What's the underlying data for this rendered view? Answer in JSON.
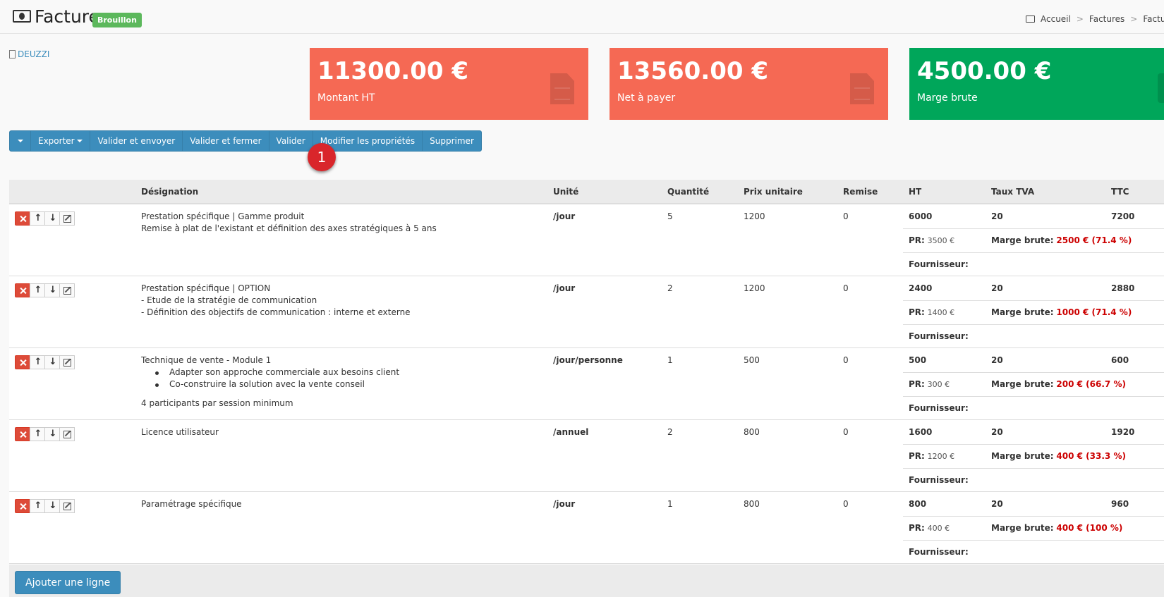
{
  "header": {
    "title": "Facture",
    "status_badge": "Brouillon",
    "breadcrumb": [
      "Accueil",
      ">",
      "Factures",
      ">",
      "Factures en"
    ]
  },
  "client": {
    "name": "DEUZZI",
    "icon": "building-icon"
  },
  "stats": [
    {
      "value": "11300.00 €",
      "label": "Montant HT",
      "color": "#f56954",
      "icon": "file-icon"
    },
    {
      "value": "13560.00 €",
      "label": "Net à payer",
      "color": "#f56954",
      "icon": "file-icon"
    },
    {
      "value": "4500.00 €",
      "label": "Marge brute",
      "color": "#00a65a",
      "icon": "money-icon"
    }
  ],
  "toolbar": {
    "export_label": "Exporter",
    "validate_send_label": "Valider et envoyer",
    "validate_close_label": "Valider et fermer",
    "validate_label": "Valider",
    "edit_props_label": "Modifier les propriétés",
    "delete_label": "Supprimer"
  },
  "marker": "1",
  "table": {
    "headers": {
      "designation": "Désignation",
      "unit": "Unité",
      "quantity": "Quantité",
      "unit_price": "Prix unitaire",
      "discount": "Remise",
      "ht": "HT",
      "vat_rate": "Taux TVA",
      "ttc": "TTC"
    },
    "pr_label": "PR:",
    "marge_label": "Marge brute:",
    "supplier_label": "Fournisseur:",
    "rows": [
      {
        "title": "Prestation spécifique | Gamme produit",
        "lines": [
          "Remise à plat de l'existant et définition des axes stratégiques à 5 ans"
        ],
        "unit": "/jour",
        "quantity": "5",
        "unit_price": "1200",
        "discount": "0",
        "ht": "6000",
        "vat": "20",
        "ttc": "7200",
        "pr": "3500 €",
        "marge": "2500 € (71.4 %)"
      },
      {
        "title": "Prestation spécifique | OPTION",
        "lines": [
          "- Etude de la stratégie de communication",
          "- Définition des objectifs de communication : interne et externe"
        ],
        "unit": "/jour",
        "quantity": "2",
        "unit_price": "1200",
        "discount": "0",
        "ht": "2400",
        "vat": "20",
        "ttc": "2880",
        "pr": "1400 €",
        "marge": "1000 € (71.4 %)"
      },
      {
        "title": "Technique de vente - Module 1",
        "bullets": [
          "Adapter son approche commerciale aux besoins client",
          "Co-construire la solution avec la vente conseil"
        ],
        "footer_line": "4 participants par session minimum",
        "unit": "/jour/personne",
        "quantity": "1",
        "unit_price": "500",
        "discount": "0",
        "ht": "500",
        "vat": "20",
        "ttc": "600",
        "pr": "300 €",
        "marge": "200 € (66.7 %)"
      },
      {
        "title": "Licence utilisateur",
        "unit": "/annuel",
        "quantity": "2",
        "unit_price": "800",
        "discount": "0",
        "ht": "1600",
        "vat": "20",
        "ttc": "1920",
        "pr": "1200 €",
        "marge": "400 € (33.3 %)"
      },
      {
        "title": "Paramétrage spécifique",
        "unit": "/jour",
        "quantity": "1",
        "unit_price": "800",
        "discount": "0",
        "ht": "800",
        "vat": "20",
        "ttc": "960",
        "pr": "400 €",
        "marge": "400 € (100 %)"
      }
    ]
  },
  "add_line_label": "Ajouter une ligne"
}
